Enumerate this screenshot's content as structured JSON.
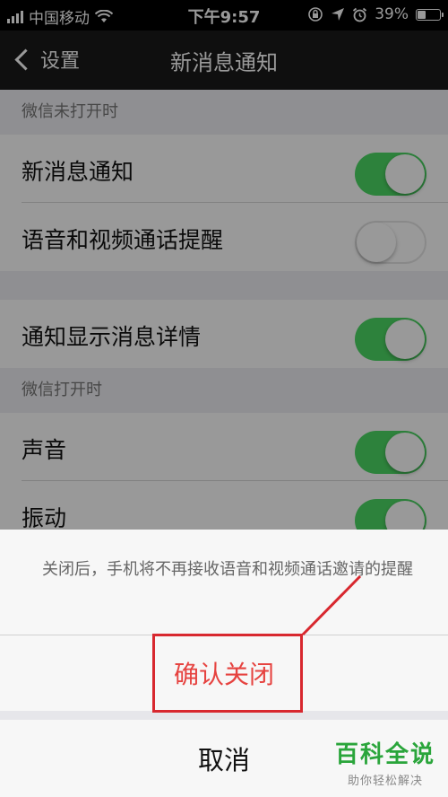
{
  "status_bar": {
    "carrier": "中国移动",
    "time": "下午9:57",
    "battery": "39%",
    "battery_level": 0.39,
    "icons": [
      "signal-icon",
      "wifi-icon",
      "lock-rotation-icon",
      "location-icon",
      "alarm-icon",
      "battery-icon"
    ]
  },
  "nav": {
    "back_label": "设置",
    "title": "新消息通知"
  },
  "sections": {
    "closed_header": "微信未打开时",
    "new_message": {
      "label": "新消息通知",
      "on": true
    },
    "call_reminder": {
      "label": "语音和视频通话提醒",
      "on": false
    },
    "show_details": {
      "label": "通知显示消息详情",
      "on": true
    },
    "open_header": "微信打开时",
    "sound": {
      "label": "声音",
      "on": true
    },
    "vibrate": {
      "label": "振动",
      "on": true
    }
  },
  "sheet": {
    "message": "关闭后，手机将不再接收语音和视频通话邀请的提醒",
    "confirm_label": "确认关闭",
    "cancel_label": "取消"
  },
  "watermark": {
    "brand": "百科全说",
    "tagline": "助你轻松解决"
  },
  "colors": {
    "toggle_on": "#4cd964",
    "destructive": "#e64340",
    "annotation": "#d8282f",
    "watermark": "#2aa53b"
  }
}
